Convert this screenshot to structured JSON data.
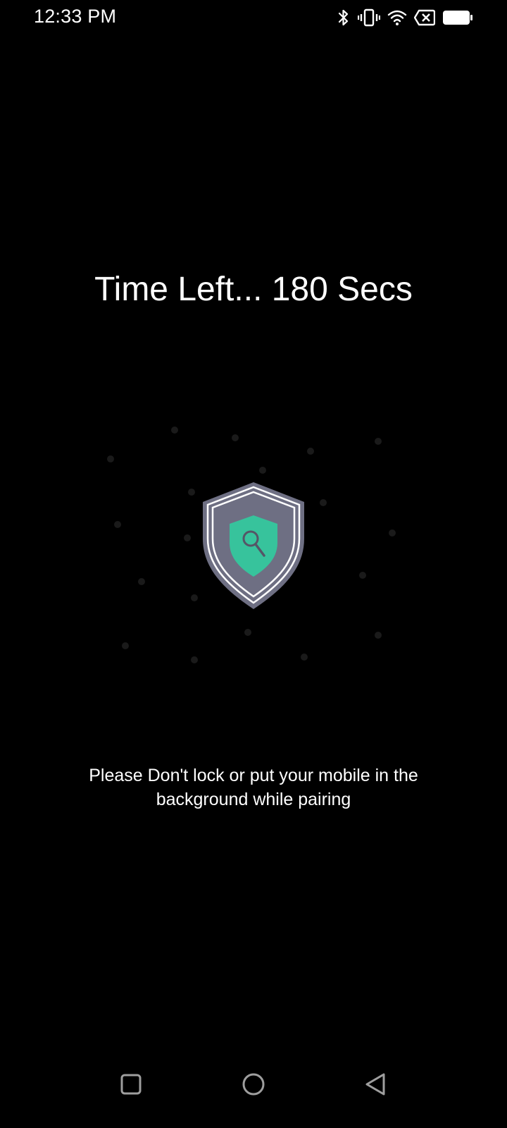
{
  "status_bar": {
    "time": "12:33 PM",
    "icons": [
      "bluetooth-icon",
      "vibrate-icon",
      "wifi-icon",
      "no-sim-icon",
      "battery-icon"
    ]
  },
  "timer": {
    "text": "Time Left... 180 Secs"
  },
  "scan_graphic": {
    "icon": "shield-search-icon",
    "shield_outer_color": "#6e6f83",
    "shield_inner_color": "#37c39c",
    "dot_color": "#1a1a1a"
  },
  "warning": {
    "text": "Please Don't lock or put your mobile in the background while pairing"
  },
  "nav_bar": {
    "recent_icon": "square-recents-icon",
    "home_icon": "circle-home-icon",
    "back_icon": "triangle-back-icon"
  },
  "colors": {
    "background": "#000000",
    "text": "#ffffff",
    "nav_icon": "#9e9e9e"
  }
}
